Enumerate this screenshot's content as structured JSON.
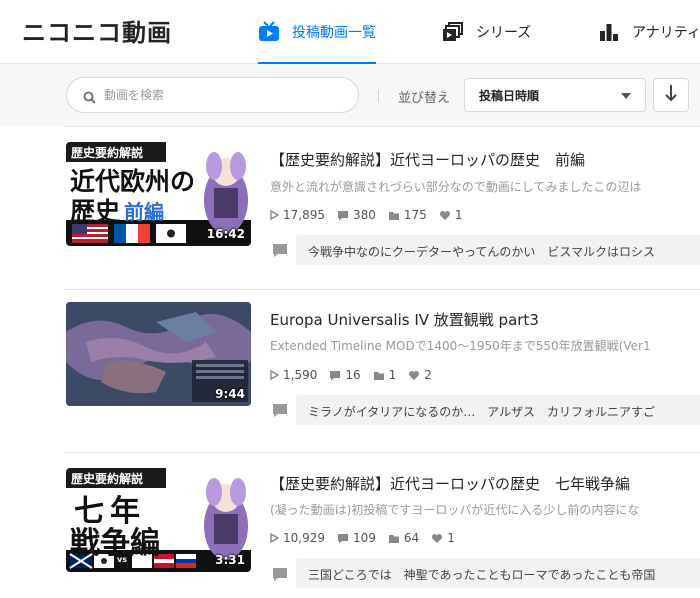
{
  "header": {
    "logo": "ニコニコ動画",
    "tabs": [
      {
        "label": "投稿動画一覧",
        "icon": "tv-icon",
        "active": true
      },
      {
        "label": "シリーズ",
        "icon": "series-icon",
        "active": false
      },
      {
        "label": "アナリティ",
        "icon": "bar-chart-icon",
        "active": false
      }
    ]
  },
  "toolbar": {
    "search_placeholder": "動画を検索",
    "sort_label": "並び替え",
    "sort_value": "投稿日時順",
    "order_icon": "arrow-down-icon"
  },
  "colors": {
    "accent": "#007cff"
  },
  "videos": [
    {
      "title": "【歴史要約解説】近代ヨーロッパの歴史　前編",
      "description": "意外と流れが意識されづらい部分なので動画にしてみましたこの辺は",
      "duration": "16:42",
      "views": "17,895",
      "comments": "380",
      "mylists": "175",
      "likes": "1",
      "latest_comments": "今戦争中なのにクーデターやってんのかい　ビスマルクはロシス",
      "thumb": {
        "banner": "歴史要約解説",
        "line1": "近代欧州の",
        "line2a": "歴史",
        "line2b": "前編"
      }
    },
    {
      "title": "Europa Universalis IV 放置観戦 part3",
      "description": "Extended Timeline MODで1400～1950年まで550年放置観戦(Ver1",
      "duration": "9:44",
      "views": "1,590",
      "comments": "16",
      "mylists": "1",
      "likes": "2",
      "latest_comments": "ミラノがイタリアになるのか…　アルザス　カリフォルニアすご"
    },
    {
      "title": "【歴史要約解説】近代ヨーロッパの歴史　七年戦争編",
      "description": "(凝った動画は)初投稿ですヨーロッパが近代に入る少し前の内容にな",
      "duration": "3:31",
      "views": "10,929",
      "comments": "109",
      "mylists": "64",
      "likes": "1",
      "latest_comments": "三国どころでは　神聖であったこともローマであったことも帝国",
      "thumb": {
        "banner": "歴史要約解説",
        "line1": "七年",
        "line2a": "戦争編",
        "vs": "vs"
      }
    }
  ]
}
